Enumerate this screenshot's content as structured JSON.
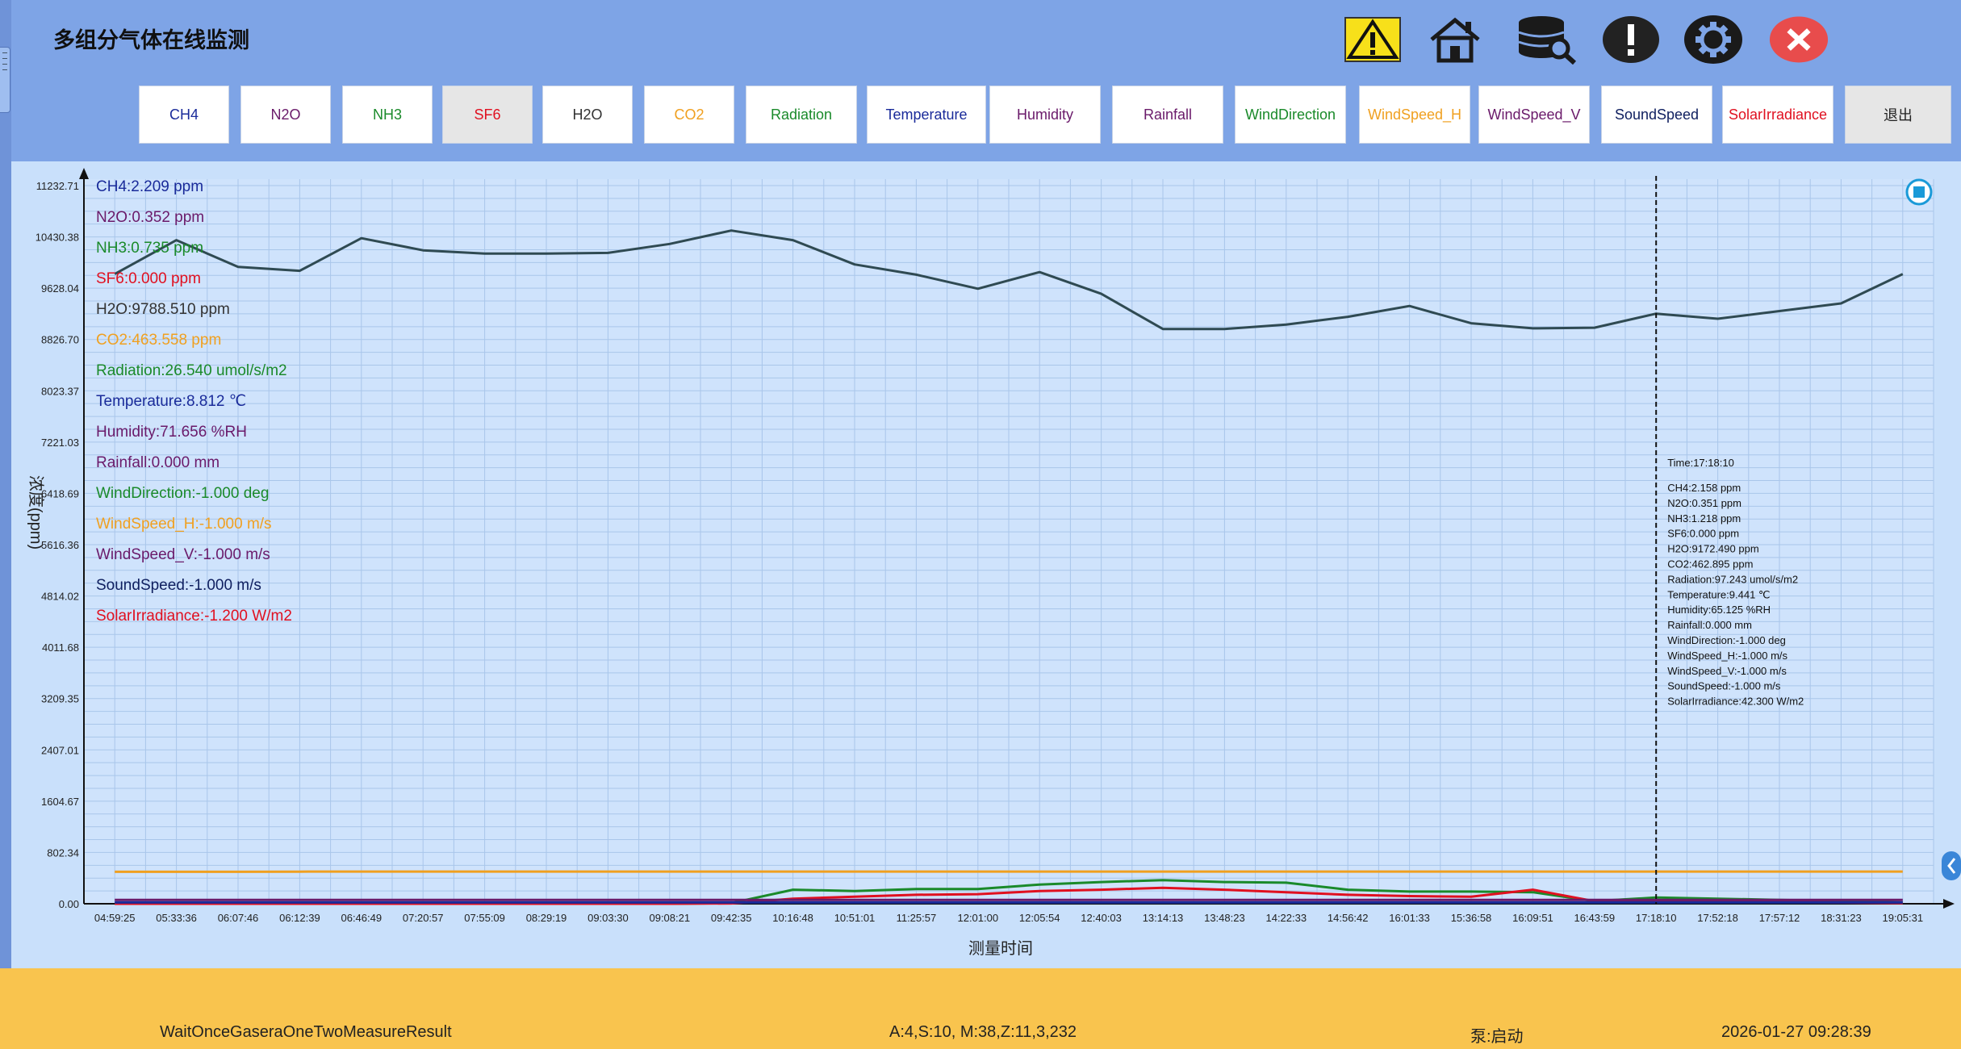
{
  "app": {
    "title": "多组分气体在线监测"
  },
  "icons": [
    "warning-icon",
    "home-icon",
    "database-search-icon",
    "alert-icon",
    "settings-icon",
    "close-icon"
  ],
  "tabs": [
    {
      "label": "CH4",
      "color": "#1a2b9a"
    },
    {
      "label": "N2O",
      "color": "#6a1a6a"
    },
    {
      "label": "NH3",
      "color": "#1a8a2a"
    },
    {
      "label": "SF6",
      "color": "#e01020",
      "active": true
    },
    {
      "label": "H2O",
      "color": "#333333"
    },
    {
      "label": "CO2",
      "color": "#f0a020"
    },
    {
      "label": "Radiation",
      "color": "#1a8a2a"
    },
    {
      "label": "Temperature",
      "color": "#1a2b9a"
    },
    {
      "label": "Humidity",
      "color": "#6a1a6a"
    },
    {
      "label": "Rainfall",
      "color": "#6a1a6a"
    },
    {
      "label": "WindDirection",
      "color": "#1a8a2a"
    },
    {
      "label": "WindSpeed_H",
      "color": "#f0a020"
    },
    {
      "label": "WindSpeed_V",
      "color": "#6a1a6a"
    },
    {
      "label": "SoundSpeed",
      "color": "#102060"
    },
    {
      "label": "SolarIrradiance",
      "color": "#e01020"
    }
  ],
  "exit_label": "退出",
  "legend": [
    {
      "text": "CH4:2.209 ppm",
      "color": "#1a2b9a"
    },
    {
      "text": "N2O:0.352 ppm",
      "color": "#6a1a6a"
    },
    {
      "text": "NH3:0.735 ppm",
      "color": "#1a8a2a"
    },
    {
      "text": "SF6:0.000 ppm",
      "color": "#e01020"
    },
    {
      "text": "H2O:9788.510 ppm",
      "color": "#333333"
    },
    {
      "text": "CO2:463.558 ppm",
      "color": "#f0a020"
    },
    {
      "text": "Radiation:26.540 umol/s/m2",
      "color": "#1a8a2a"
    },
    {
      "text": "Temperature:8.812 ℃",
      "color": "#1a2b9a"
    },
    {
      "text": "Humidity:71.656 %RH",
      "color": "#6a1a6a"
    },
    {
      "text": "Rainfall:0.000 mm",
      "color": "#6a1a6a"
    },
    {
      "text": "WindDirection:-1.000 deg",
      "color": "#1a8a2a"
    },
    {
      "text": "WindSpeed_H:-1.000 m/s",
      "color": "#f0a020"
    },
    {
      "text": "WindSpeed_V:-1.000 m/s",
      "color": "#6a1a6a"
    },
    {
      "text": "SoundSpeed:-1.000 m/s",
      "color": "#102060"
    },
    {
      "text": "SolarIrradiance:-1.200 W/m2",
      "color": "#e01020"
    }
  ],
  "tooltip": {
    "time": "Time:17:18:10",
    "lines": [
      "CH4:2.158 ppm",
      "N2O:0.351 ppm",
      "NH3:1.218 ppm",
      "SF6:0.000 ppm",
      "H2O:9172.490 ppm",
      "CO2:462.895 ppm",
      "Radiation:97.243 umol/s/m2",
      "Temperature:9.441 ℃",
      "Humidity:65.125 %RH",
      "Rainfall:0.000 mm",
      "WindDirection:-1.000 deg",
      "WindSpeed_H:-1.000 m/s",
      "WindSpeed_V:-1.000 m/s",
      "SoundSpeed:-1.000 m/s",
      "SolarIrradiance:42.300 W/m2"
    ]
  },
  "chart_data": {
    "type": "line",
    "xlabel": "测量时间",
    "ylabel": "浓度(ppm)",
    "ylim": [
      0,
      11232.77
    ],
    "y_ticks": [
      "0.00",
      "802.34",
      "1604.67",
      "2407.01",
      "3209.35",
      "4011.68",
      "4814.02",
      "5616.36",
      "6418.69",
      "7221.03",
      "8023.37",
      "8826.70",
      "9628.04",
      "10430.38",
      "11232.71"
    ],
    "x_ticks": [
      "04:59:25",
      "05:33:36",
      "06:07:46",
      "06:12:39",
      "06:46:49",
      "07:20:57",
      "07:55:09",
      "08:29:19",
      "09:03:30",
      "09:08:21",
      "09:42:35",
      "10:16:48",
      "10:51:01",
      "11:25:57",
      "12:01:00",
      "12:05:54",
      "12:40:03",
      "13:14:13",
      "13:48:23",
      "14:22:33",
      "14:56:42",
      "16:01:33",
      "15:36:58",
      "16:09:51",
      "16:43:59",
      "17:18:10",
      "17:52:18",
      "17:57:12",
      "18:31:23",
      "19:05:31"
    ],
    "grid": true,
    "cursor_x": "17:18:10",
    "series": [
      {
        "name": "H2O",
        "color": "#2f4a52",
        "values": [
          9850,
          10380,
          9960,
          9900,
          10410,
          10220,
          10170,
          10170,
          10180,
          10320,
          10530,
          10380,
          10000,
          9840,
          9620,
          9880,
          9540,
          8990,
          8990,
          9060,
          9180,
          9350,
          9080,
          9000,
          9010,
          9230,
          9150,
          9270,
          9390,
          9850
        ]
      },
      {
        "name": "CO2",
        "color": "#f0a020",
        "values": [
          500,
          500,
          500,
          502,
          503,
          503,
          503,
          503,
          503,
          503,
          503,
          503,
          503,
          503,
          503,
          503,
          503,
          503,
          503,
          503,
          503,
          503,
          503,
          503,
          503,
          503,
          503,
          503,
          503,
          503
        ]
      },
      {
        "name": "Radiation",
        "color": "#1a8a2a",
        "values": [
          0,
          0,
          0,
          0,
          0,
          0,
          0,
          0,
          0,
          0,
          10,
          220,
          200,
          230,
          230,
          300,
          340,
          370,
          340,
          330,
          220,
          190,
          190,
          180,
          40,
          97,
          80,
          60,
          40,
          20
        ]
      },
      {
        "name": "SolarIrradiance",
        "color": "#e01020",
        "values": [
          0,
          0,
          0,
          0,
          0,
          0,
          0,
          0,
          0,
          0,
          5,
          80,
          110,
          140,
          150,
          200,
          220,
          250,
          220,
          180,
          140,
          120,
          110,
          220,
          40,
          42,
          40,
          30,
          20,
          10
        ]
      },
      {
        "name": "N2O",
        "color": "#6a1a6a",
        "values": [
          60,
          60,
          60,
          60,
          60,
          60,
          60,
          60,
          60,
          60,
          60,
          60,
          60,
          60,
          60,
          60,
          60,
          60,
          60,
          60,
          60,
          60,
          60,
          60,
          60,
          60,
          60,
          60,
          60,
          60
        ]
      },
      {
        "name": "CH4",
        "color": "#1a2b9a",
        "values": [
          20,
          20,
          20,
          20,
          20,
          20,
          20,
          20,
          20,
          20,
          20,
          20,
          20,
          20,
          20,
          20,
          20,
          20,
          20,
          20,
          20,
          20,
          20,
          20,
          20,
          20,
          20,
          20,
          20,
          20
        ]
      }
    ]
  },
  "status": {
    "message": "WaitOnceGaseraOneTwoMeasureResult",
    "params": "A:4,S:10, M:38,Z:11,3,232",
    "pump": "泵:启动",
    "datetime": "2026-01-27 09:28:39"
  }
}
